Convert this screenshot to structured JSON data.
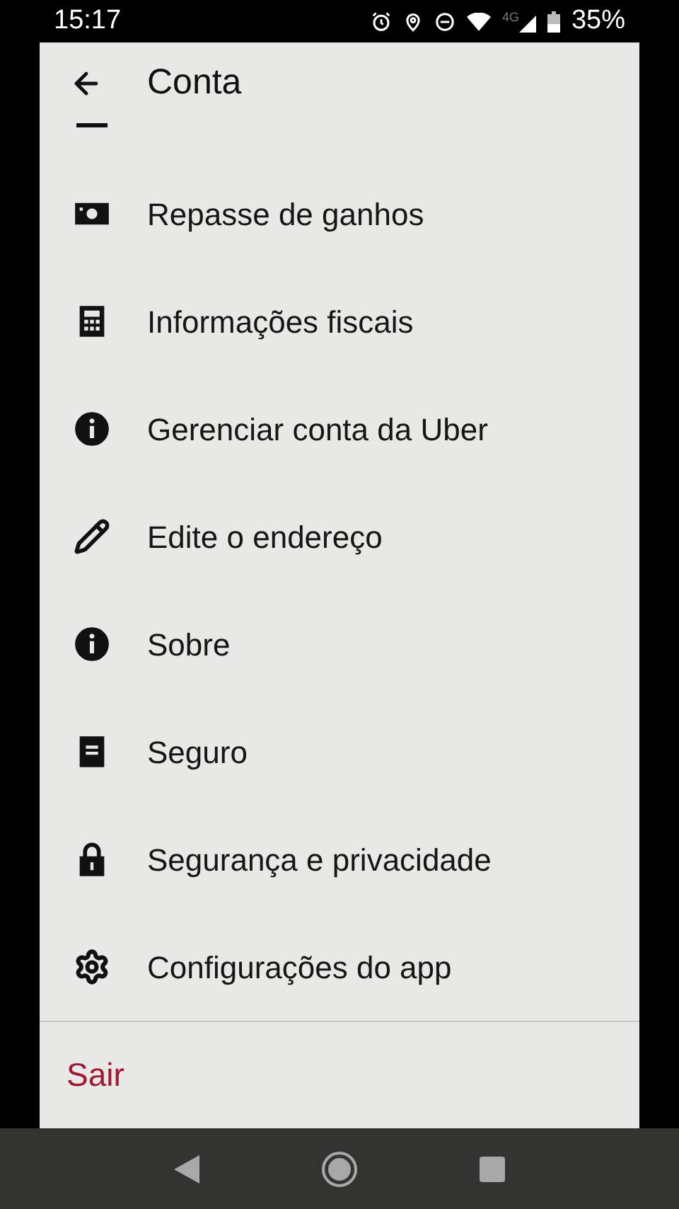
{
  "status_bar": {
    "time": "15:17",
    "network": "4G",
    "battery": "35%"
  },
  "header": {
    "title": "Conta"
  },
  "menu_items": [
    {
      "kind": "banknote",
      "label": "Repasse de ganhos"
    },
    {
      "kind": "calculator",
      "label": "Informações fiscais"
    },
    {
      "kind": "info",
      "label": "Gerenciar conta da Uber"
    },
    {
      "kind": "pencil",
      "label": "Edite o endereço"
    },
    {
      "kind": "info",
      "label": "Sobre"
    },
    {
      "kind": "document",
      "label": "Seguro"
    },
    {
      "kind": "lock",
      "label": "Segurança e privacidade"
    },
    {
      "kind": "gear",
      "label": "Configurações do app"
    }
  ],
  "logout": {
    "label": "Sair"
  }
}
